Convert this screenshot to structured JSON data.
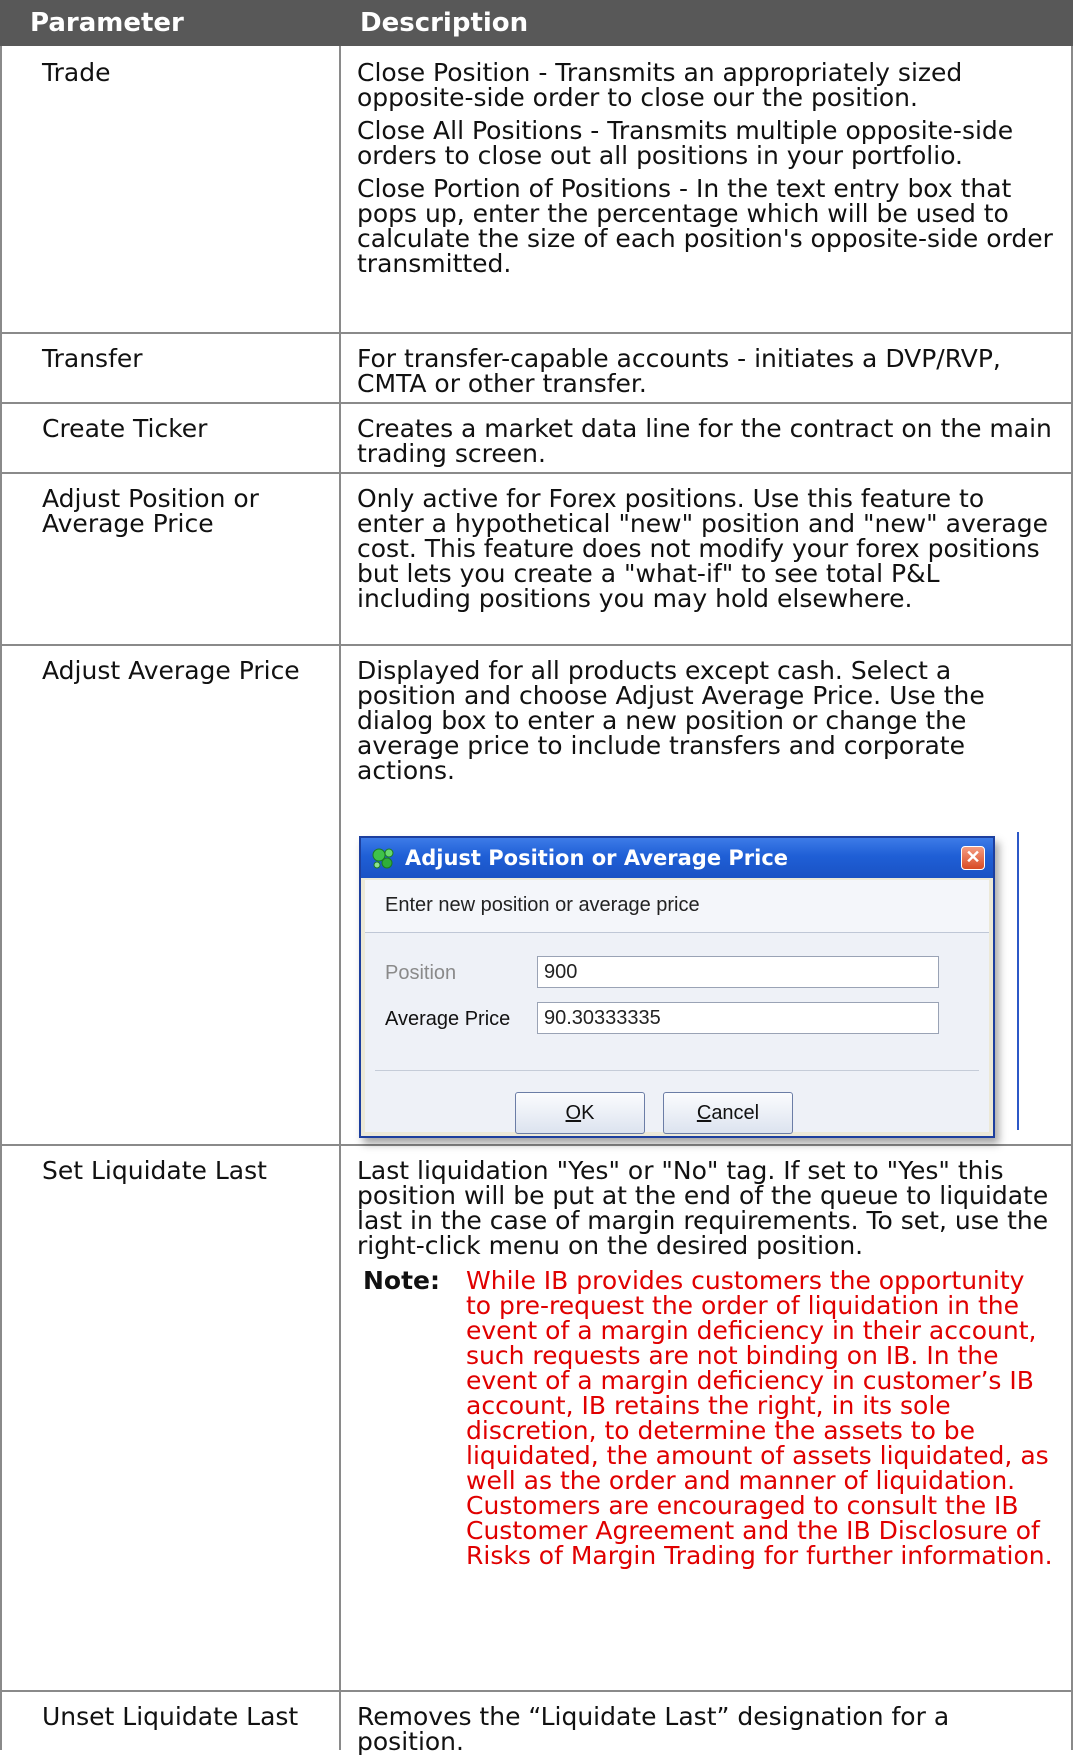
{
  "header": {
    "parameter": "Parameter",
    "description": "Description"
  },
  "rows": [
    {
      "parameter": "Trade",
      "paragraphs": [
        "Close Position - Transmits an appropriately sized opposite-side order to close our the position.",
        "Close All Positions - Transmits multiple opposite-side orders to close out all positions in your portfolio.",
        "Close Portion of Positions - In the text entry box that pops up, enter the percentage which will be used to calculate the size of each position's opposite-side order transmitted."
      ]
    },
    {
      "parameter": "Transfer",
      "paragraphs": [
        "For transfer-capable accounts - initiates a DVP/RVP, CMTA or other transfer."
      ]
    },
    {
      "parameter": "Create Ticker",
      "paragraphs": [
        "Creates a market data line for the contract on the main trading screen."
      ]
    },
    {
      "parameter": "Adjust Position or Average Price",
      "paragraphs": [
        "Only active for Forex positions. Use this feature to enter a hypothetical \"new\" position and \"new\" average cost. This feature does not modify your forex positions but lets you create a \"what-if\" to see total P&L including positions you may hold elsewhere."
      ]
    },
    {
      "parameter": "Adjust Average Price",
      "paragraphs": [
        "Displayed for all products except cash. Select a position and choose Adjust Average Price. Use the dialog box to enter a new position or change the average price to include transfers and corporate actions."
      ]
    },
    {
      "parameter": "Set Liquidate Last",
      "paragraphs": [
        "Last liquidation \"Yes\" or \"No\" tag. If set to \"Yes\" this position will be put at the end of the queue to liquidate last in the case of margin requirements. To set, use the right-click menu on the desired position."
      ],
      "note_label": "Note:",
      "note_text": "While IB provides customers the opportunity to pre-request the order of liquidation in the event of a margin deficiency in their account, such requests are not binding on IB. In the event of a margin deficiency in customer’s IB account, IB retains the right, in its sole discretion, to determine the assets to be liquidated, the amount of assets liquidated, as well as the order and manner of liquidation. Customers are encouraged to consult the IB Customer Agreement and the IB Disclosure of Risks of Margin Trading for further information."
    },
    {
      "parameter": "Unset Liquidate Last",
      "paragraphs": [
        "Removes the “Liquidate Last” designation for a position."
      ]
    }
  ],
  "dialog": {
    "title": "Adjust Position or Average Price",
    "subtitle": "Enter new position or average price",
    "position_label": "Position",
    "position_value": "900",
    "avg_price_label": "Average Price",
    "avg_price_value": "90.30333335",
    "ok_key": "O",
    "ok_rest": "K",
    "cancel_key": "C",
    "cancel_rest": "ancel",
    "app_icon": "green-molecule-icon",
    "close_icon": "close-icon"
  },
  "colors": {
    "header_bg": "#585858",
    "note_text": "#e00000",
    "title_bar": "#1f5fd6"
  }
}
